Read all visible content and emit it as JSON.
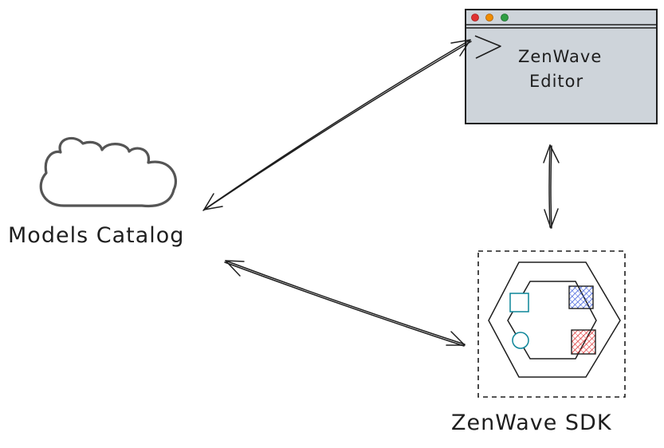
{
  "nodes": {
    "catalog": {
      "label": "Models Catalog",
      "icon": "cloud-icon"
    },
    "editor": {
      "label_line1": "ZenWave",
      "label_line2": "Editor",
      "icon": "editor-window-icon"
    },
    "sdk": {
      "label": "ZenWave SDK",
      "icon": "hexagonal-architecture-icon"
    }
  },
  "colors": {
    "stroke": "#1e1e1e",
    "window_fill": "#ced4da",
    "dot_red": "#e03131",
    "dot_yellow": "#f08c00",
    "dot_green": "#2f9e44",
    "port_green": "#0c8599",
    "adapter_blue": "#3b5bdb",
    "adapter_red": "#e03131"
  },
  "edges": [
    {
      "from": "catalog",
      "to": "editor",
      "arrows": "both"
    },
    {
      "from": "editor",
      "to": "sdk",
      "arrows": "both"
    },
    {
      "from": "catalog",
      "to": "sdk",
      "arrows": "both"
    }
  ]
}
